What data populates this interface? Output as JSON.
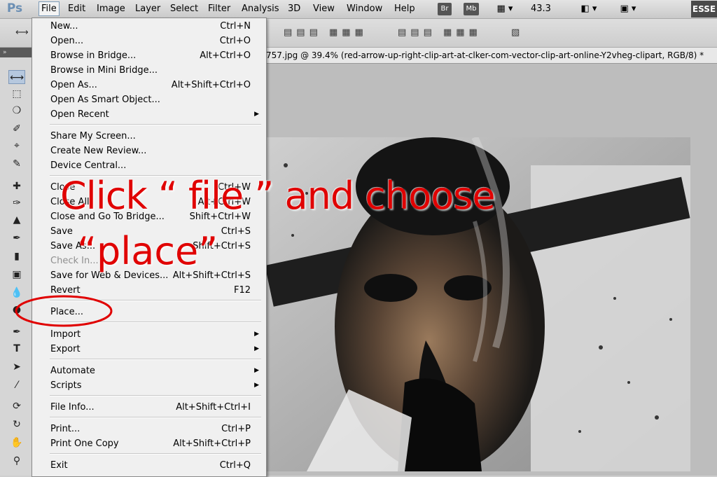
{
  "app": {
    "logo": "Ps",
    "workspace_label": "ESSE",
    "zoom": "43.3"
  },
  "menubar": {
    "items": [
      "File",
      "Edit",
      "Image",
      "Layer",
      "Select",
      "Filter",
      "Analysis",
      "3D",
      "View",
      "Window",
      "Help"
    ],
    "bridge_btn": "Br",
    "minibridge_btn": "Mb"
  },
  "document_tab": {
    "title": "757.jpg @ 39.4% (red-arrow-up-right-clip-art-at-clker-com-vector-clip-art-online-Y2vheg-clipart, RGB/8) *"
  },
  "file_menu": {
    "items": [
      {
        "label": "New...",
        "shortcut": "Ctrl+N"
      },
      {
        "label": "Open...",
        "shortcut": "Ctrl+O"
      },
      {
        "label": "Browse in Bridge...",
        "shortcut": "Alt+Ctrl+O"
      },
      {
        "label": "Browse in Mini Bridge...",
        "shortcut": ""
      },
      {
        "label": "Open As...",
        "shortcut": "Alt+Shift+Ctrl+O"
      },
      {
        "label": "Open As Smart Object...",
        "shortcut": ""
      },
      {
        "label": "Open Recent",
        "shortcut": ""
      },
      {
        "label": "Share My Screen...",
        "shortcut": ""
      },
      {
        "label": "Create New Review...",
        "shortcut": ""
      },
      {
        "label": "Device Central...",
        "shortcut": ""
      },
      {
        "label": "Close",
        "shortcut": "Ctrl+W"
      },
      {
        "label": "Close All",
        "shortcut": "Alt+Ctrl+W"
      },
      {
        "label": "Close and Go To Bridge...",
        "shortcut": "Shift+Ctrl+W"
      },
      {
        "label": "Save",
        "shortcut": "Ctrl+S"
      },
      {
        "label": "Save As...",
        "shortcut": "Shift+Ctrl+S"
      },
      {
        "label": "Check In...",
        "shortcut": ""
      },
      {
        "label": "Save for Web & Devices...",
        "shortcut": "Alt+Shift+Ctrl+S"
      },
      {
        "label": "Revert",
        "shortcut": "F12"
      },
      {
        "label": "Place...",
        "shortcut": ""
      },
      {
        "label": "Import",
        "shortcut": ""
      },
      {
        "label": "Export",
        "shortcut": ""
      },
      {
        "label": "Automate",
        "shortcut": ""
      },
      {
        "label": "Scripts",
        "shortcut": ""
      },
      {
        "label": "File Info...",
        "shortcut": "Alt+Shift+Ctrl+I"
      },
      {
        "label": "Print...",
        "shortcut": "Ctrl+P"
      },
      {
        "label": "Print One Copy",
        "shortcut": "Alt+Shift+Ctrl+P"
      },
      {
        "label": "Exit",
        "shortcut": "Ctrl+Q"
      }
    ]
  },
  "annotation": {
    "line1": "Click “ file ” and choose",
    "line2": "“place”",
    "color": "#e00000"
  },
  "colors": {
    "menu_bg": "#f0f0f0",
    "highlight": "#e00000"
  }
}
